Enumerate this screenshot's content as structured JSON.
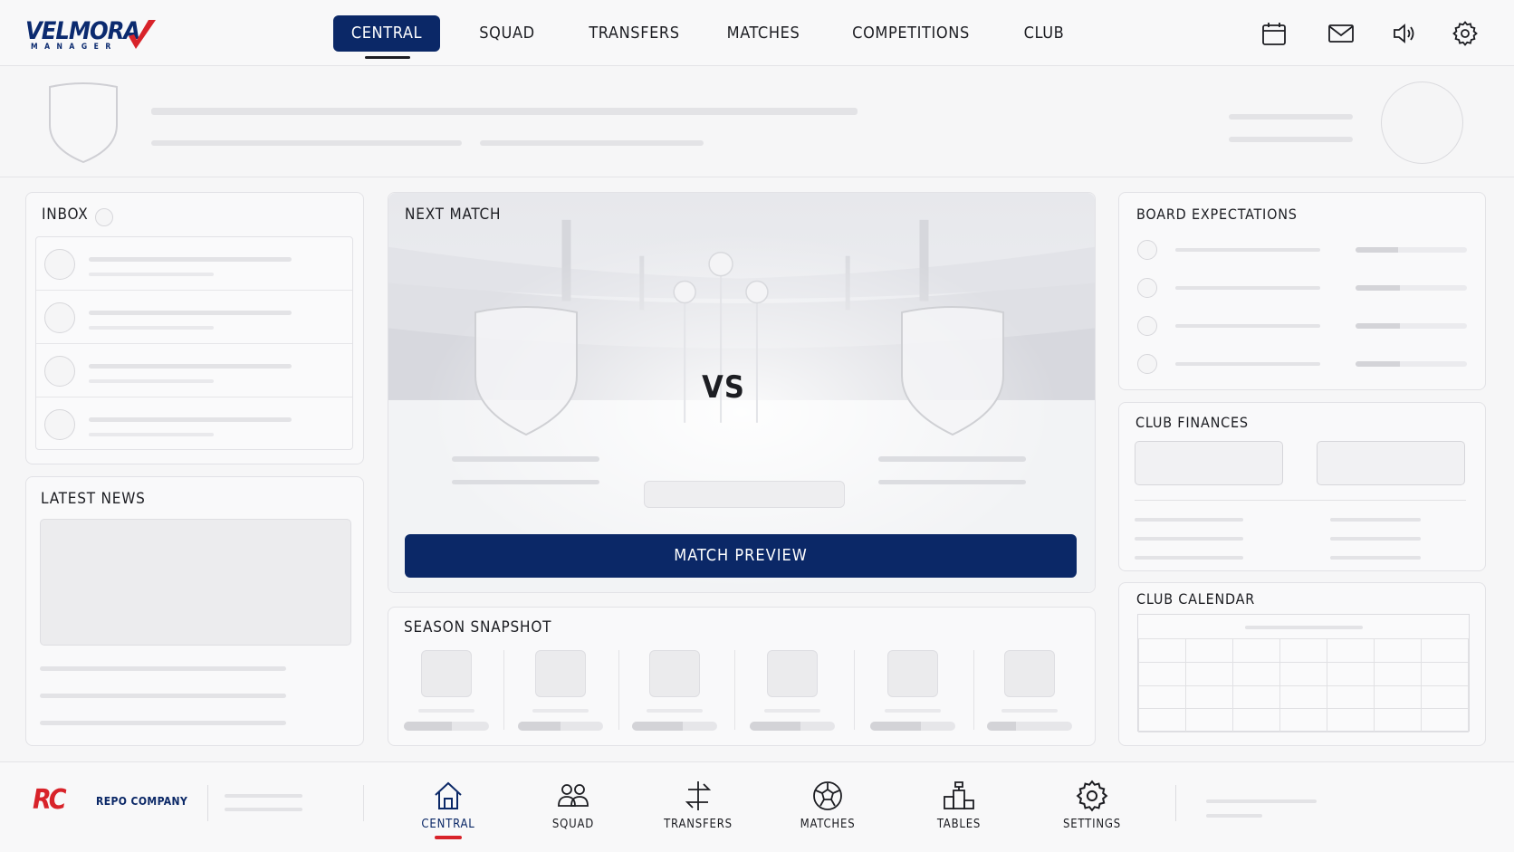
{
  "brand": {
    "name": "VELMORA",
    "sub": "MANAGER",
    "primary_color": "#0b2867",
    "accent_color": "#d8232a"
  },
  "topnav": {
    "items": [
      {
        "label": "CENTRAL",
        "active": true
      },
      {
        "label": "SQUAD"
      },
      {
        "label": "TRANSFERS"
      },
      {
        "label": "MATCHES"
      },
      {
        "label": "COMPETITIONS"
      },
      {
        "label": "CLUB"
      }
    ],
    "icons": [
      "calendar-icon",
      "mail-icon",
      "speaker-icon",
      "settings-gear-icon"
    ]
  },
  "inbox": {
    "title": "INBOX"
  },
  "latest_news": {
    "title": "LATEST NEWS"
  },
  "next_match": {
    "title": "NEXT MATCH",
    "vs": "VS",
    "button": "MATCH PREVIEW"
  },
  "season_snapshot": {
    "title": "SEASON SNAPSHOT",
    "progress": [
      0.56,
      0.5,
      0.6,
      0.6,
      0.6,
      0.34
    ]
  },
  "board_expectations": {
    "title": "BOARD EXPECTATIONS",
    "progress": [
      0.38,
      0.4,
      0.4,
      0.4
    ]
  },
  "club_finances": {
    "title": "CLUB FINANCES"
  },
  "club_calendar": {
    "title": "CLUB CALENDAR"
  },
  "footer": {
    "sponsor_mark": "RC",
    "sponsor": "REPO COMPANY",
    "items": [
      {
        "label": "CENTRAL",
        "icon": "home-icon",
        "active": true
      },
      {
        "label": "SQUAD",
        "icon": "people-icon"
      },
      {
        "label": "TRANSFERS",
        "icon": "transfer-arrows-icon"
      },
      {
        "label": "MATCHES",
        "icon": "football-icon"
      },
      {
        "label": "TABLES",
        "icon": "podium-icon"
      },
      {
        "label": "SETTINGS",
        "icon": "settings-gear-icon"
      }
    ]
  }
}
